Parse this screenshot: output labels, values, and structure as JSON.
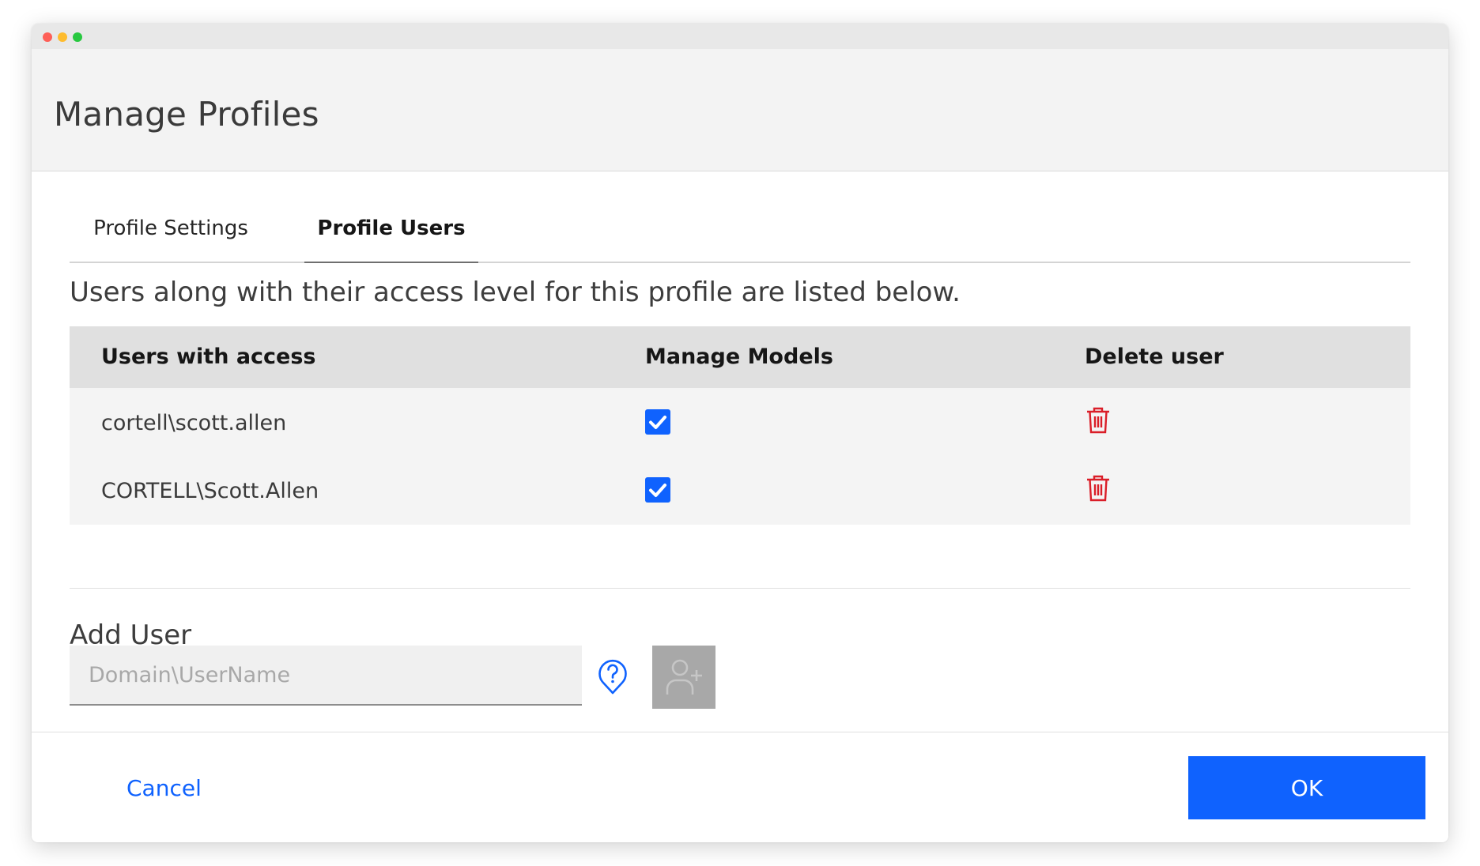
{
  "dialog": {
    "title": "Manage Profiles"
  },
  "tabs": [
    {
      "label": "Profile Settings",
      "active": false
    },
    {
      "label": "Profile Users",
      "active": true
    }
  ],
  "description": "Users along with their access level for this profile are listed below.",
  "table": {
    "columns": [
      "Users with access",
      "Manage Models",
      "Delete user"
    ],
    "rows": [
      {
        "user": "cortell\\scott.allen",
        "manage_models": true
      },
      {
        "user": "CORTELL\\Scott.Allen",
        "manage_models": true
      }
    ]
  },
  "add_user": {
    "label": "Add User",
    "placeholder": "Domain\\UserName",
    "value": ""
  },
  "footer": {
    "cancel_label": "Cancel",
    "ok_label": "OK"
  },
  "icons": {
    "help": "help-pin-icon",
    "add_user": "add-user-icon",
    "delete": "trash-icon",
    "check": "checkmark-icon"
  },
  "colors": {
    "accent": "#0f62fe",
    "danger": "#da1e28",
    "disabled": "#a8a8a8",
    "header_bg": "#f3f3f3",
    "table_head_bg": "#e0e0e0",
    "table_body_bg": "#f4f4f4"
  }
}
